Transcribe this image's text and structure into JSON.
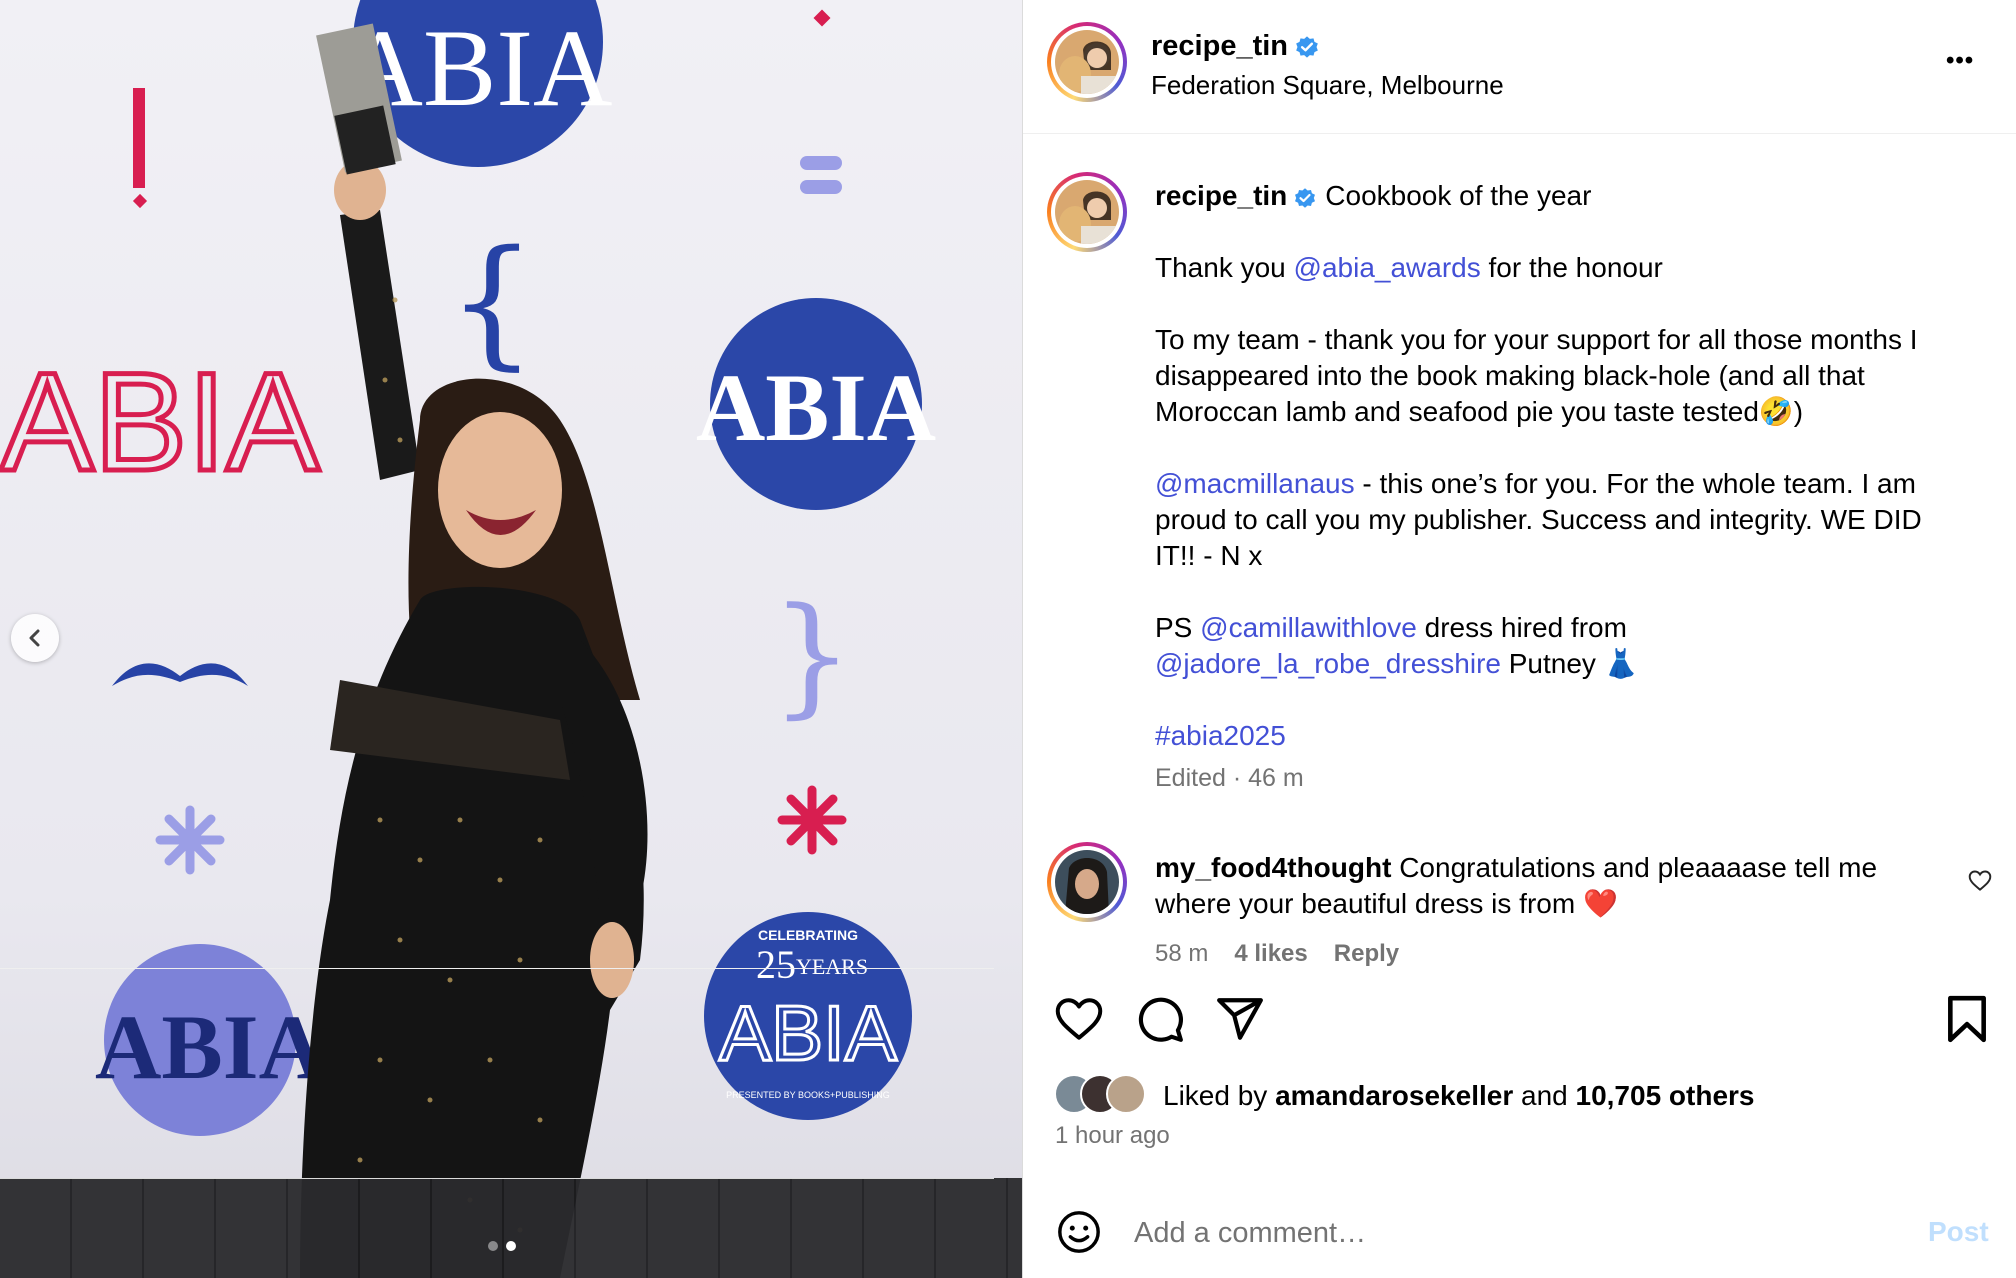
{
  "post": {
    "author": "recipe_tin",
    "location": "Federation Square, Melbourne",
    "more_label": "•••"
  },
  "caption": {
    "author": "recipe_tin",
    "headline": "Cookbook of the year",
    "line1_prefix": "Thank you ",
    "line1_mention": "@abia_awards",
    "line1_suffix": " for the honour",
    "para2": "To my team - thank you for your support for all those months I disappeared into the book making black-hole (and all that Moroccan lamb and seafood pie you taste tested🤣)",
    "para3_mention": "@macmillanaus",
    "para3_text": " - this one’s for you. For the whole team. I am proud to call you my publisher. Success and integrity. WE DID IT!! - N x",
    "ps_prefix": "PS ",
    "ps_mention1": "@camillawithlove",
    "ps_middle": " dress hired from",
    "ps_mention2": "@jadore_la_robe_dresshire",
    "ps_suffix": " Putney 👗",
    "hashtag": "#abia2025",
    "meta": "Edited · 46 m"
  },
  "comment": {
    "author": "my_food4thought",
    "text": " Congratulations and pleaaaase tell me where your beautiful dress is from ❤️",
    "time": "58 m",
    "likes": "4 likes",
    "reply": "Reply"
  },
  "likes": {
    "prefix": "Liked by ",
    "user": "amandarosekeller",
    "middle": " and ",
    "count": "10,705 others",
    "time": "1 hour ago"
  },
  "composer": {
    "placeholder": "Add a comment…",
    "post_label": "Post"
  },
  "photo": {
    "logo_text": "ABIA",
    "anniversary_top": "CELEBRATING",
    "anniversary_years": "25",
    "anniversary_word": "YEARS",
    "sponsor": "PRESENTED BY BOOKS+PUBLISHING"
  },
  "colors": {
    "link": "#4350d6",
    "verified": "#3897f0",
    "brand_blue": "#2743a6",
    "brand_red": "#d81e50",
    "lavender": "#9b9ee6"
  }
}
